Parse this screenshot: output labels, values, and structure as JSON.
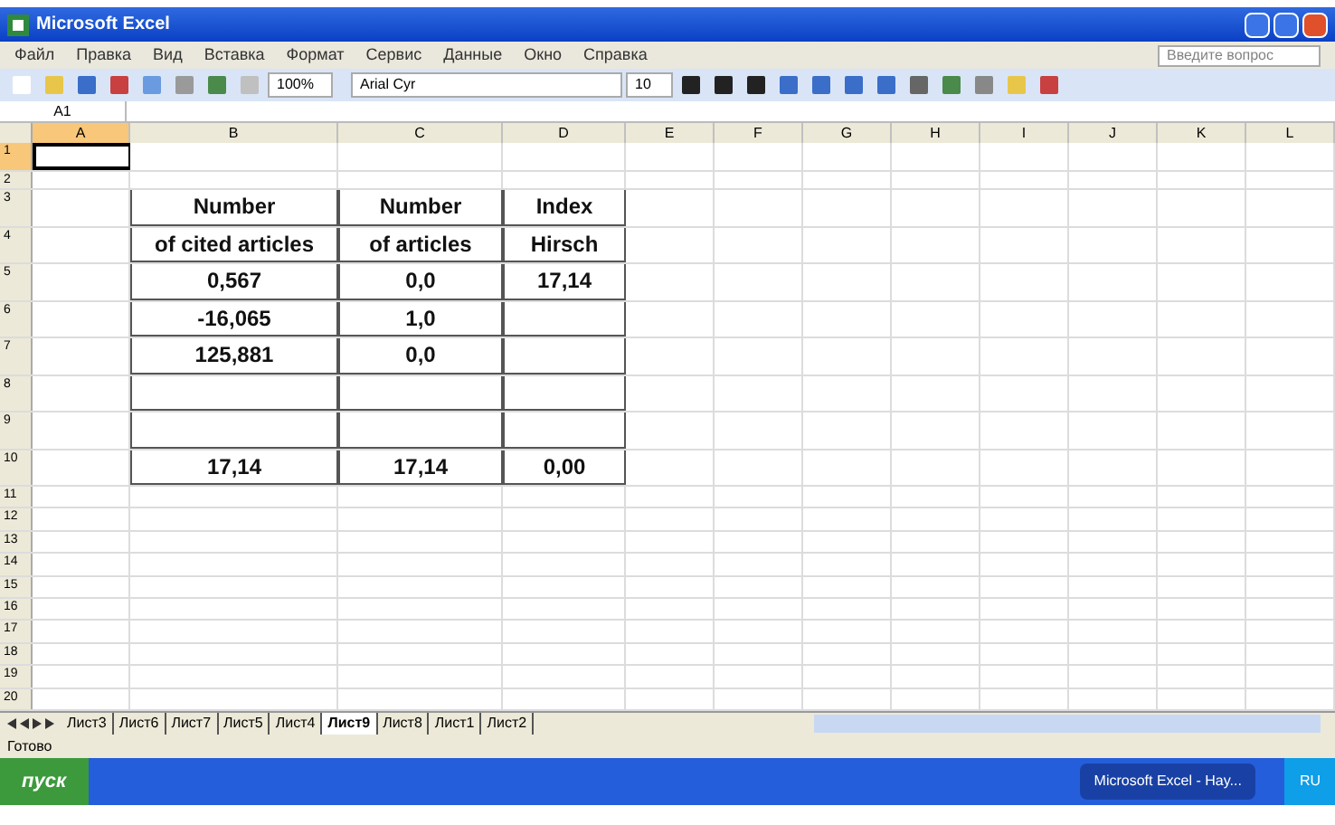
{
  "window": {
    "title": "Microsoft Excel"
  },
  "menu": [
    {
      "label": "Файл"
    },
    {
      "label": "Правка"
    },
    {
      "label": "Вид"
    },
    {
      "label": "Вставка"
    },
    {
      "label": "Формат"
    },
    {
      "label": "Сервис"
    },
    {
      "label": "Данные"
    },
    {
      "label": "Окно"
    },
    {
      "label": "Справка"
    }
  ],
  "help_search": {
    "placeholder": "Введите вопрос"
  },
  "toolbar": {
    "zoom": "100%",
    "font": "Arial Cyr",
    "size": "10"
  },
  "formula_bar": {
    "name_box": "A1"
  },
  "columns": [
    {
      "label": "A",
      "selected": true
    },
    {
      "label": "B",
      "selected": false
    },
    {
      "label": "C",
      "selected": false
    },
    {
      "label": "D",
      "selected": false
    },
    {
      "label": "E",
      "selected": false
    },
    {
      "label": "F",
      "selected": false
    },
    {
      "label": "G",
      "selected": false
    },
    {
      "label": "H",
      "selected": false
    },
    {
      "label": "I",
      "selected": false
    },
    {
      "label": "J",
      "selected": false
    },
    {
      "label": "K",
      "selected": false
    },
    {
      "label": "L",
      "selected": false
    }
  ],
  "rows": [
    {
      "number": "1",
      "kind": "plain",
      "selected": true
    },
    {
      "number": "2",
      "kind": "plain",
      "selected": false
    },
    {
      "number": "3",
      "kind": "table",
      "selected": false,
      "cells": [
        "Number",
        "Number",
        "Index"
      ]
    },
    {
      "number": "4",
      "kind": "table",
      "selected": false,
      "cells": [
        "of cited articles",
        "of articles",
        "Hirsch"
      ]
    },
    {
      "number": "5",
      "kind": "table",
      "selected": false,
      "cells": [
        "0,567",
        "0,0",
        "17,14"
      ]
    },
    {
      "number": "6",
      "kind": "table",
      "selected": false,
      "cells": [
        "-16,065",
        "1,0",
        ""
      ]
    },
    {
      "number": "7",
      "kind": "table",
      "selected": false,
      "cells": [
        "125,881",
        "0,0",
        ""
      ]
    },
    {
      "number": "8",
      "kind": "table",
      "selected": false,
      "cells": [
        "",
        "",
        ""
      ]
    },
    {
      "number": "9",
      "kind": "table",
      "selected": false,
      "cells": [
        "",
        "",
        ""
      ]
    },
    {
      "number": "10",
      "kind": "table",
      "selected": false,
      "cells": [
        "17,14",
        "17,14",
        "0,00"
      ]
    },
    {
      "number": "11",
      "kind": "plain",
      "selected": false
    },
    {
      "number": "12",
      "kind": "plain",
      "selected": false
    },
    {
      "number": "13",
      "kind": "plain",
      "selected": false
    },
    {
      "number": "14",
      "kind": "plain",
      "selected": false
    },
    {
      "number": "15",
      "kind": "plain",
      "selected": false
    },
    {
      "number": "16",
      "kind": "plain",
      "selected": false
    },
    {
      "number": "17",
      "kind": "plain",
      "selected": false
    },
    {
      "number": "18",
      "kind": "plain",
      "selected": false
    },
    {
      "number": "19",
      "kind": "plain",
      "selected": false
    },
    {
      "number": "20",
      "kind": "plain",
      "selected": false
    }
  ],
  "sheet_tabs": [
    {
      "label": "Лист3",
      "selected": false
    },
    {
      "label": "Лист6",
      "selected": false
    },
    {
      "label": "Лист7",
      "selected": false
    },
    {
      "label": "Лист5",
      "selected": false
    },
    {
      "label": "Лист4",
      "selected": false
    },
    {
      "label": "Лист9",
      "selected": true
    },
    {
      "label": "Лист8",
      "selected": false
    },
    {
      "label": "Лист1",
      "selected": false
    },
    {
      "label": "Лист2",
      "selected": false
    }
  ],
  "status_bar": {
    "text": "Готово"
  },
  "taskbar": {
    "start": "пуск",
    "tasks": [
      {
        "label": "Microsoft Excel - Hay...",
        "selected": true
      }
    ],
    "language": "RU"
  }
}
